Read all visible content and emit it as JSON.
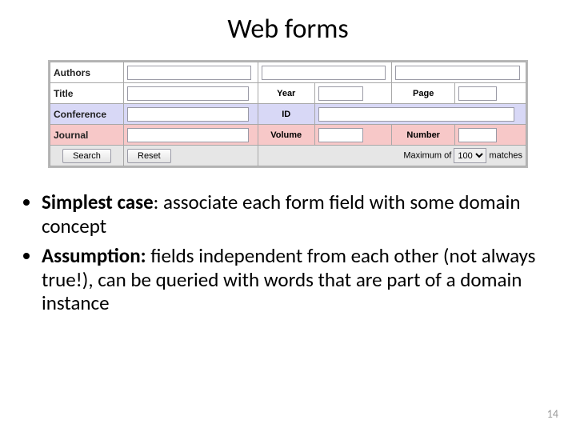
{
  "title": "Web forms",
  "form": {
    "labels": {
      "authors": "Authors",
      "title": "Title",
      "year": "Year",
      "page": "Page",
      "conference": "Conference",
      "id": "ID",
      "journal": "Journal",
      "volume": "Volume",
      "number": "Number"
    },
    "controls": {
      "search": "Search",
      "reset": "Reset",
      "max_prefix": "Maximum of",
      "max_suffix": "matches",
      "max_value": "100"
    }
  },
  "bullets": {
    "b1_bold": "Simplest case",
    "b1_rest": ": associate each form field with some domain concept",
    "b2_bold": "Assumption:",
    "b2_rest": " fields independent from each other (not always true!), can be queried with words that are part of a domain instance"
  },
  "page_number": "14"
}
